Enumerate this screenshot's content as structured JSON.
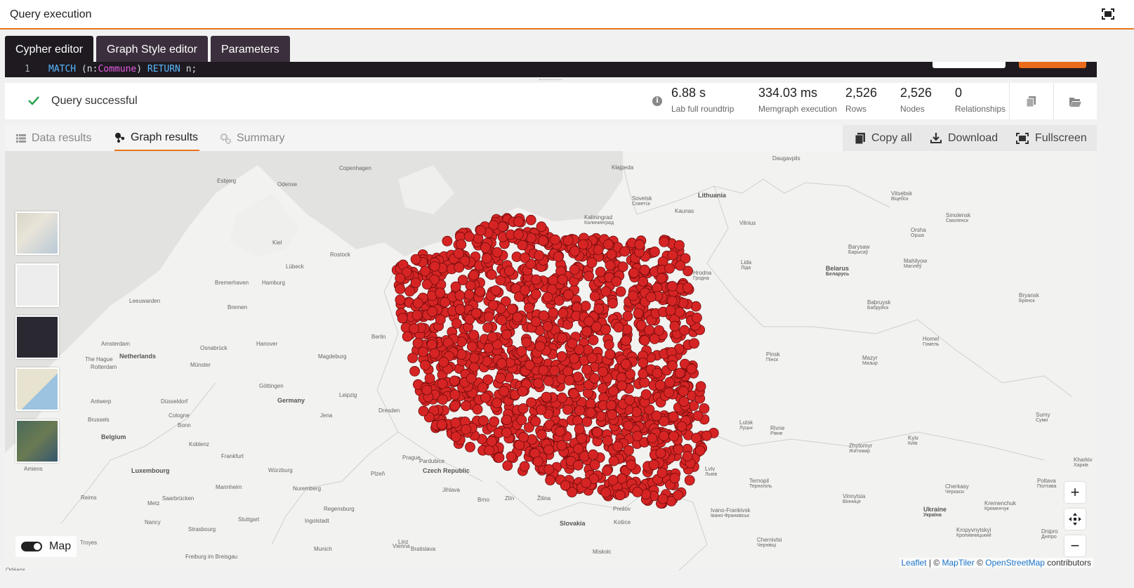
{
  "window": {
    "title": "Query execution",
    "fullscreen_icon": "expand-icon"
  },
  "editor_tabs": [
    {
      "label": "Cypher editor",
      "active": true
    },
    {
      "label": "Graph Style editor",
      "active": false
    },
    {
      "label": "Parameters",
      "active": false
    }
  ],
  "editor": {
    "line_number": "1",
    "code": {
      "kw1": "MATCH",
      "p1": " (n:",
      "label": "Commune",
      "p2": ") ",
      "kw2": "RETURN",
      "p3": " n;"
    }
  },
  "status": {
    "message": "Query successful",
    "metrics": [
      {
        "value": "6.88 s",
        "label": "Lab full roundtrip"
      },
      {
        "value": "334.03 ms",
        "label": "Memgraph execution"
      },
      {
        "value": "2,526",
        "label": "Rows"
      },
      {
        "value": "2,526",
        "label": "Nodes"
      },
      {
        "value": "0",
        "label": "Relationships"
      }
    ]
  },
  "result_tabs": [
    {
      "label": "Data results",
      "icon": "list-icon",
      "active": false
    },
    {
      "label": "Graph results",
      "icon": "graph-icon",
      "active": true
    },
    {
      "label": "Summary",
      "icon": "gears-icon",
      "active": false
    }
  ],
  "result_actions": {
    "copy": "Copy all",
    "download": "Download",
    "fullscreen": "Fullscreen"
  },
  "map": {
    "toggle_label": "Map",
    "toggle_on": true,
    "node_color": "#d62424",
    "zoom_in": "+",
    "zoom_out": "−",
    "attribution": {
      "leaflet": "Leaflet",
      "sep1": " | © ",
      "maptiler": "MapTiler",
      "sep2": " © ",
      "osm": "OpenStreetMap",
      "suffix": " contributors"
    },
    "places": [
      {
        "t": "Copenhagen"
      },
      {
        "t": "Kłajpeda"
      },
      {
        "t": "Daugavpils"
      },
      {
        "t": "Esbjerg"
      },
      {
        "t": "Odense"
      },
      {
        "t": "Lithuania",
        "big": true
      },
      {
        "t": "Sovetsk\nСоветск"
      },
      {
        "t": "Kaunas"
      },
      {
        "t": "Vilnius"
      },
      {
        "t": "Vitsebsk\nВіцебск"
      },
      {
        "t": "Smolensk\nСмоленск"
      },
      {
        "t": "Kaliningrad\nКалининград"
      },
      {
        "t": "Kiel"
      },
      {
        "t": "Rostock"
      },
      {
        "t": "Lübeck"
      },
      {
        "t": "Orsha\nОрша"
      },
      {
        "t": "Barysaw\nБарысаў"
      },
      {
        "t": "Mahilyow\nМагілёў"
      },
      {
        "t": "Belarus\nБеларусь",
        "big": true
      },
      {
        "t": "Lida\nЛіда"
      },
      {
        "t": "Hrodna\nГродна"
      },
      {
        "t": "Bremerhaven"
      },
      {
        "t": "Hamburg"
      },
      {
        "t": "Leeuwarden"
      },
      {
        "t": "Bremen"
      },
      {
        "t": "Babruysk\nБабруйск"
      },
      {
        "t": "Bryansk\nБрянск"
      },
      {
        "t": "Berlin"
      },
      {
        "t": "Amsterdam"
      },
      {
        "t": "Netherlands",
        "big": true
      },
      {
        "t": "Osnabrück"
      },
      {
        "t": "Hanover"
      },
      {
        "t": "Magdeburg"
      },
      {
        "t": "The Hague"
      },
      {
        "t": "Rotterdam"
      },
      {
        "t": "Münster"
      },
      {
        "t": "Homel\nГомель"
      },
      {
        "t": "Pinsk\nПінск"
      },
      {
        "t": "Mazyr\nМазыр"
      },
      {
        "t": "Göttingen"
      },
      {
        "t": "Leipzig"
      },
      {
        "t": "Dresden"
      },
      {
        "t": "Germany",
        "big": true
      },
      {
        "t": "Antwerp"
      },
      {
        "t": "Düsseldorf"
      },
      {
        "t": "Brussels"
      },
      {
        "t": "Cologne"
      },
      {
        "t": "Bonn"
      },
      {
        "t": "Jena"
      },
      {
        "t": "Belgium",
        "big": true
      },
      {
        "t": "Koblenz"
      },
      {
        "t": "Frankfurt"
      },
      {
        "t": "Würzburg"
      },
      {
        "t": "Prague"
      },
      {
        "t": "Lutsk\nЛуцьк"
      },
      {
        "t": "Rivne\nРівне"
      },
      {
        "t": "Zhytomyr\nЖитомир"
      },
      {
        "t": "Kyiv\nКиїв"
      },
      {
        "t": "Sumy\nСуми"
      },
      {
        "t": "Luxembourg",
        "big": true
      },
      {
        "t": "Pardubice"
      },
      {
        "t": "Czech Republic",
        "big": true
      },
      {
        "t": "Plzeň"
      },
      {
        "t": "Lviv\nЛьвів"
      },
      {
        "t": "Ternopil\nТернопіль"
      },
      {
        "t": "Kharkiv\nХарків"
      },
      {
        "t": "Poltava\nПолтава"
      },
      {
        "t": "Cherkasy\nЧеркаси"
      },
      {
        "t": "Jihlava"
      },
      {
        "t": "Brno"
      },
      {
        "t": "Zlín"
      },
      {
        "t": "Žilina"
      },
      {
        "t": "Prešov"
      },
      {
        "t": "Vinnytsia\nВінниця"
      },
      {
        "t": "Kremenchuk\nКременчук"
      },
      {
        "t": "Mannheim"
      },
      {
        "t": "Nuremberg"
      },
      {
        "t": "Saarbrücken"
      },
      {
        "t": "Reims"
      },
      {
        "t": "Metz"
      },
      {
        "t": "Regensburg"
      },
      {
        "t": "Ivano-Frankivsk\nІвано-Франківськ"
      },
      {
        "t": "Ukraine\nУкраїна",
        "big": true
      },
      {
        "t": "Nancy"
      },
      {
        "t": "Stuttgart"
      },
      {
        "t": "Ingolstadt"
      },
      {
        "t": "Linz"
      },
      {
        "t": "Slovakia",
        "big": true
      },
      {
        "t": "Košice"
      },
      {
        "t": "Kropyvnytskyi\nКропивницький"
      },
      {
        "t": "Strasbourg"
      },
      {
        "t": "Munich"
      },
      {
        "t": "Vienna"
      },
      {
        "t": "Bratislava"
      },
      {
        "t": "Chernivtsi\nЧернівці"
      },
      {
        "t": "Dnipro\nДніпро"
      },
      {
        "t": "Freiburg im Breisgau"
      },
      {
        "t": "Troyes"
      },
      {
        "t": "Amiens"
      },
      {
        "t": "Orléans"
      },
      {
        "t": "Miskolc"
      }
    ]
  }
}
